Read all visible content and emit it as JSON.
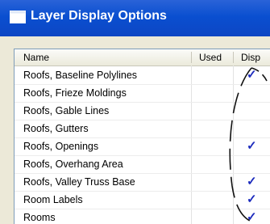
{
  "window": {
    "title": "Layer Display Options"
  },
  "list": {
    "columns": [
      "Name",
      "Used",
      "Disp"
    ],
    "rows": [
      {
        "name": "Roofs, Baseline Polylines",
        "disp": "✓"
      },
      {
        "name": "Roofs, Frieze Moldings",
        "disp": ""
      },
      {
        "name": "Roofs, Gable Lines",
        "disp": ""
      },
      {
        "name": "Roofs, Gutters",
        "disp": ""
      },
      {
        "name": "Roofs, Openings",
        "disp": "✓"
      },
      {
        "name": "Roofs, Overhang Area",
        "disp": ""
      },
      {
        "name": "Roofs, Valley Truss Base",
        "disp": "✓"
      },
      {
        "name": "Room Labels",
        "disp": "✓"
      },
      {
        "name": "Rooms",
        "disp": "✓"
      }
    ]
  },
  "colors": {
    "titlebar": "#0a4fd0",
    "check": "#1c2bbd"
  }
}
